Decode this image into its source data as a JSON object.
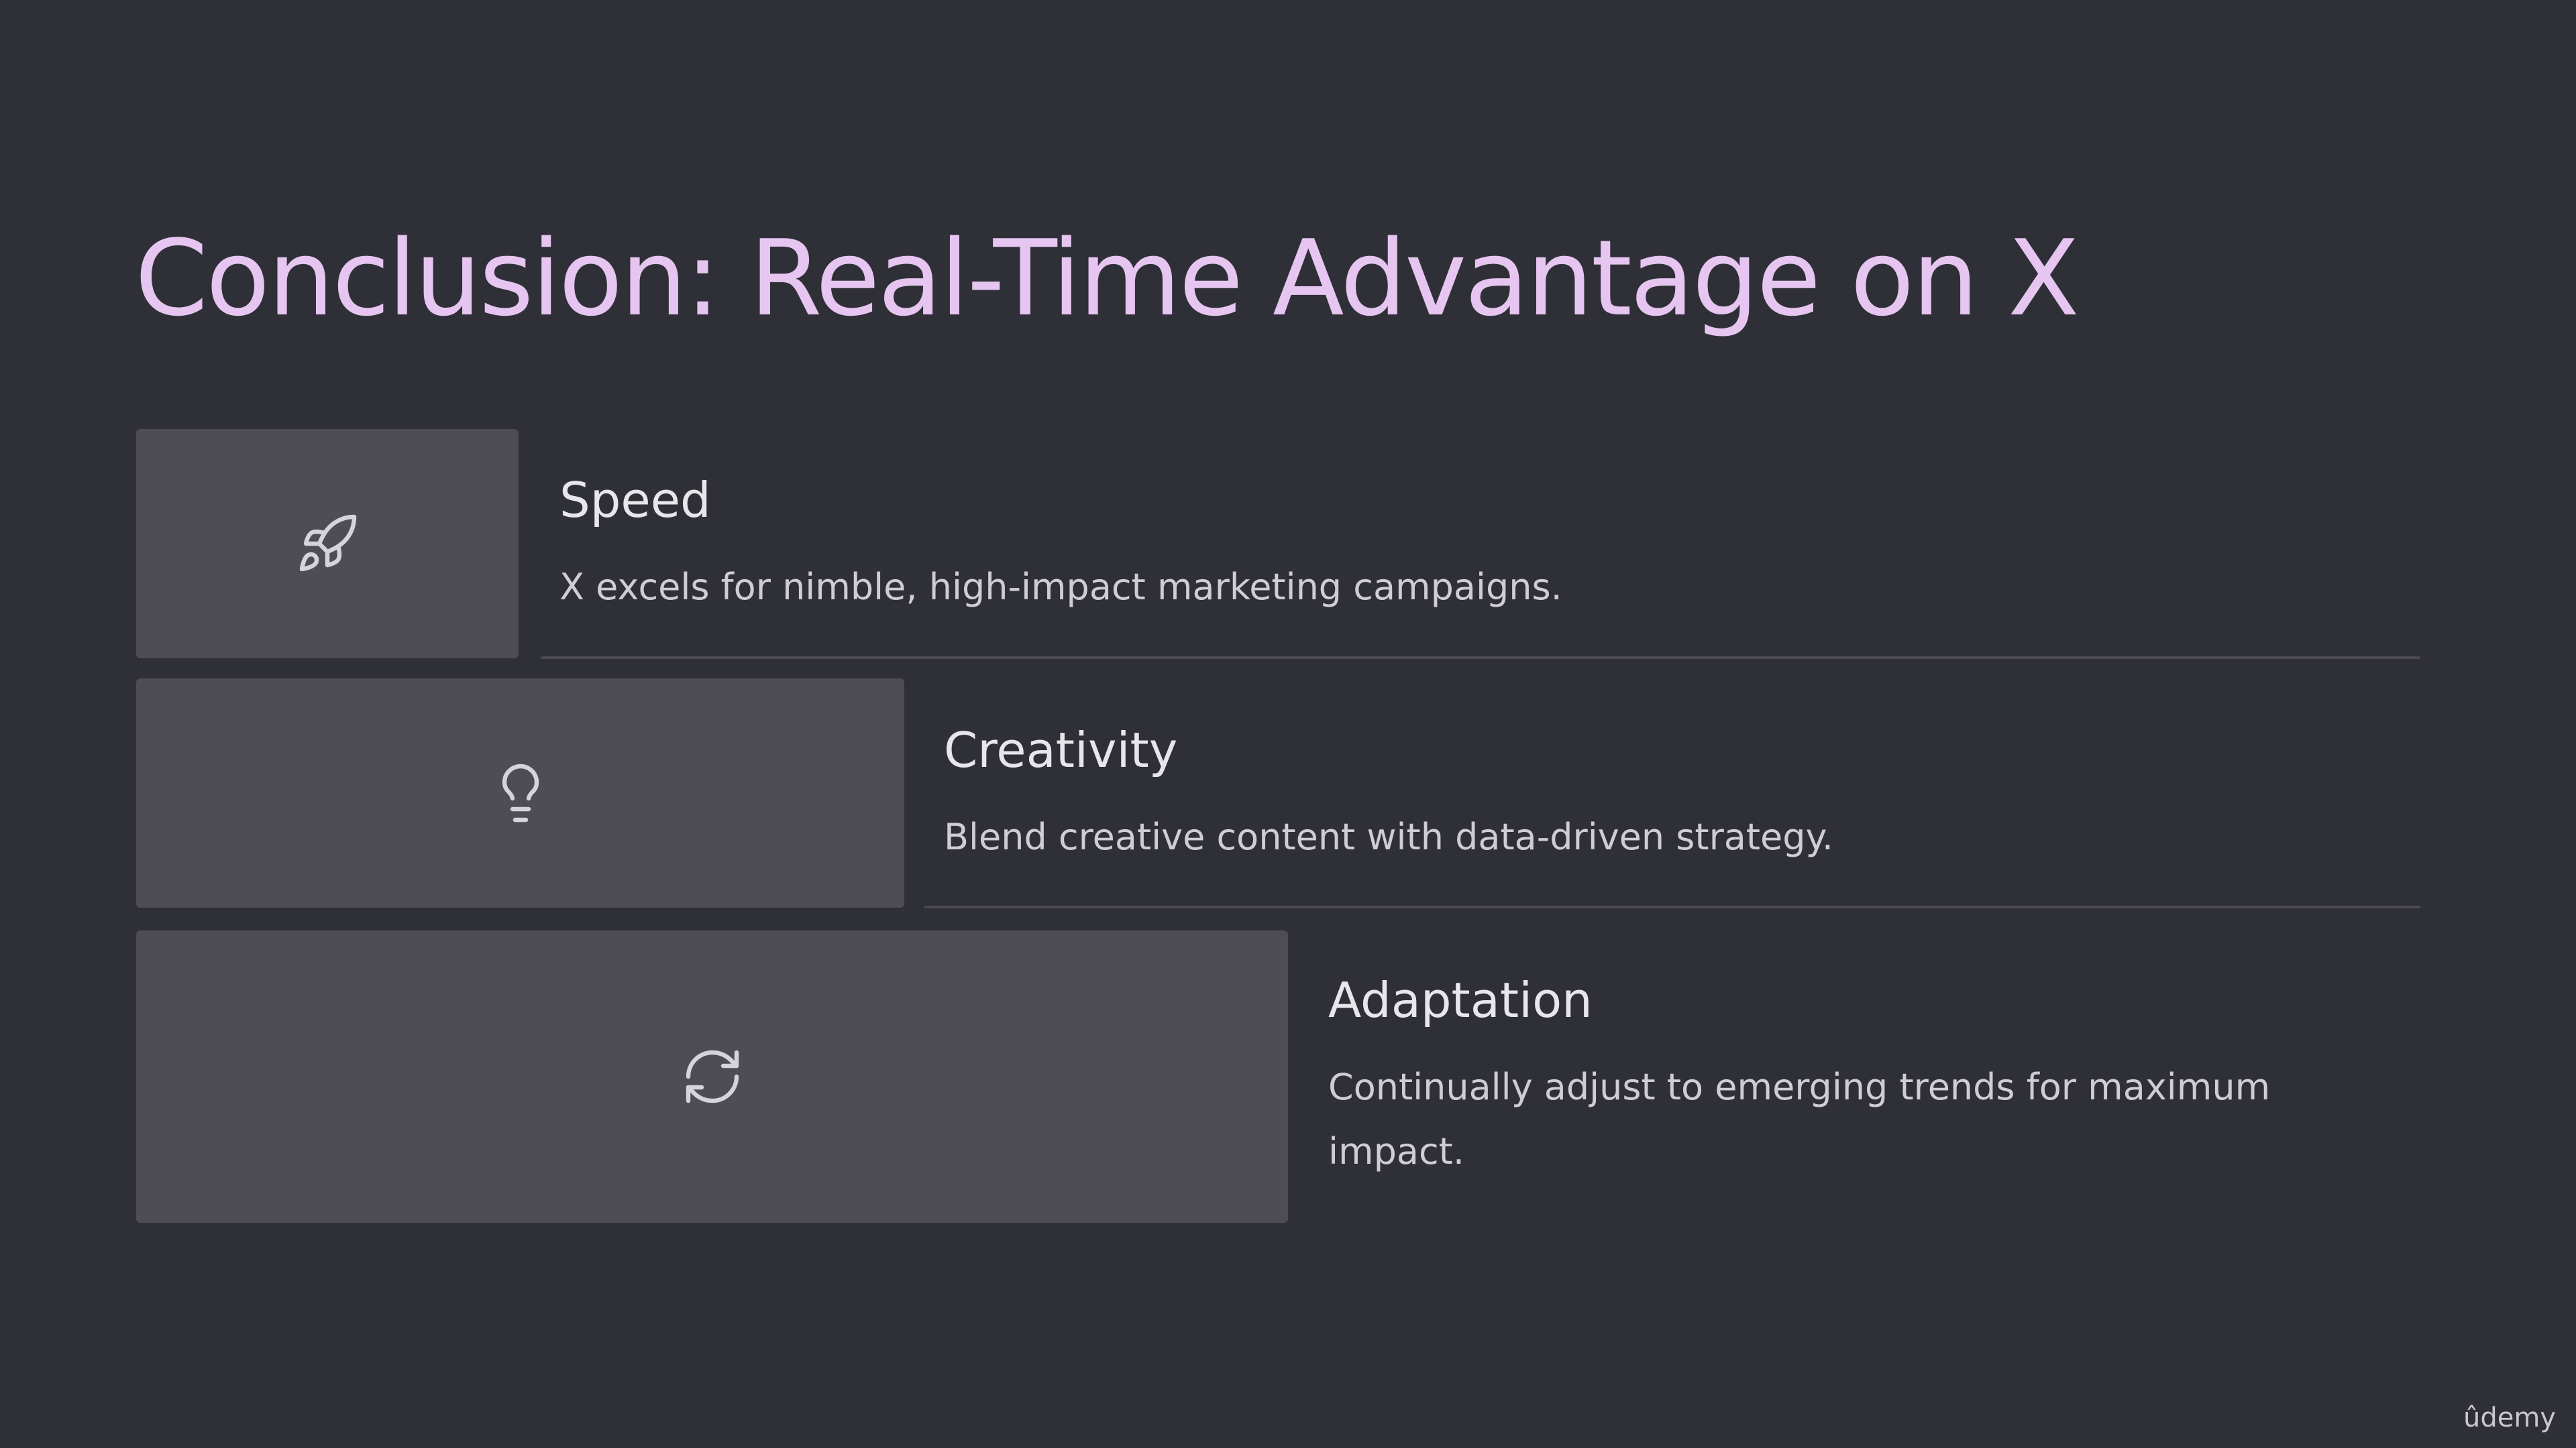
{
  "slide": {
    "title": "Conclusion: Real-Time Advantage on X",
    "colors": {
      "background": "#2f3037",
      "title": "#e6c6f0",
      "card": "#4e4c54",
      "divider": "#4b4a51"
    },
    "items": [
      {
        "heading": "Speed",
        "description": "X excels for nimble, high-impact marketing campaigns.",
        "icon": "rocket-icon"
      },
      {
        "heading": "Creativity",
        "description": "Blend creative content with data-driven strategy.",
        "icon": "lightbulb-icon"
      },
      {
        "heading": "Adaptation",
        "description": "Continually adjust to emerging trends for maximum impact.",
        "icon": "refresh-icon"
      }
    ]
  },
  "watermark": "ûdemy"
}
